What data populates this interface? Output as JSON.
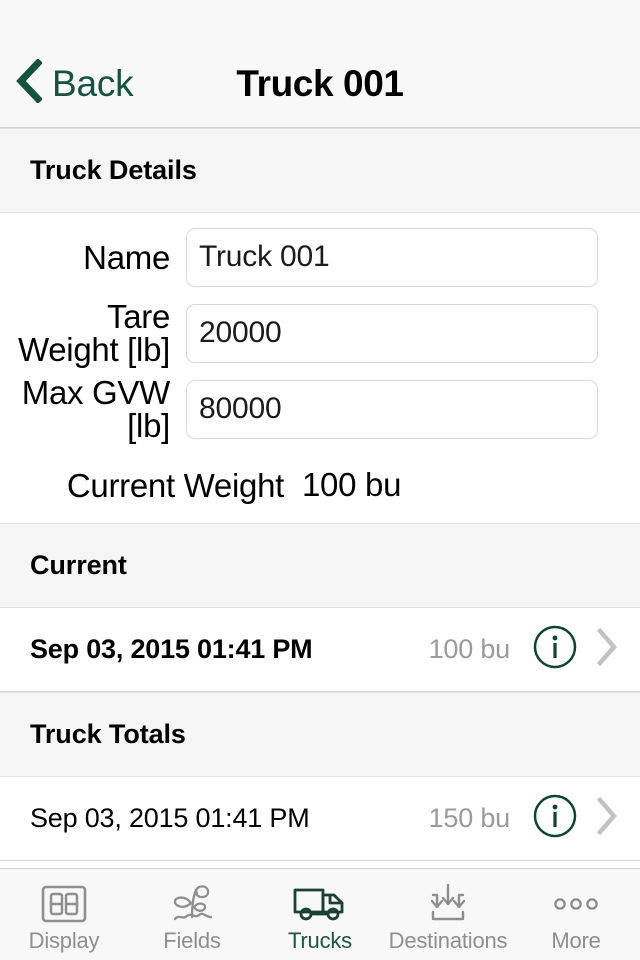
{
  "colors": {
    "accent_green": "#15523f",
    "tab_active_green": "#1e5440",
    "icon_gray": "#8e8e8e",
    "muted_text": "#9a9a9a",
    "section_band": "#f5f5f5",
    "navbar_bg": "#f8f8f8"
  },
  "navbar": {
    "back_label": "Back",
    "back_icon": "chevron-left-icon",
    "title": "Truck 001"
  },
  "sections": {
    "details": {
      "header": "Truck Details",
      "fields": [
        {
          "label": "Name",
          "value": "Truck 001",
          "type": "input",
          "name": "name-field"
        },
        {
          "label": "Tare Weight [lb]",
          "value": "20000",
          "type": "input",
          "name": "tare-weight-field"
        },
        {
          "label": "Max GVW [lb]",
          "value": "80000",
          "type": "input",
          "name": "max-gvw-field"
        },
        {
          "label": "Current Weight",
          "value": "100 bu",
          "type": "static",
          "name": "current-weight-value"
        }
      ]
    },
    "current": {
      "header": "Current",
      "rows": [
        {
          "date": "Sep 03, 2015 01:41 PM",
          "amount": "100 bu",
          "bold": true,
          "info_icon": "info-circle-icon",
          "disclosure_icon": "chevron-right-icon"
        }
      ]
    },
    "truck_totals": {
      "header": "Truck Totals",
      "rows": [
        {
          "date": "Sep 03, 2015 01:41 PM",
          "amount": "150 bu",
          "bold": false,
          "info_icon": "info-circle-icon",
          "disclosure_icon": "chevron-right-icon"
        }
      ]
    }
  },
  "tabbar": {
    "items": [
      {
        "label": "Display",
        "icon": "seven-segment-display-icon",
        "active": false
      },
      {
        "label": "Fields",
        "icon": "sprout-icon",
        "active": false
      },
      {
        "label": "Trucks",
        "icon": "truck-icon",
        "active": true
      },
      {
        "label": "Destinations",
        "icon": "arrows-into-bin-icon",
        "active": false
      },
      {
        "label": "More",
        "icon": "three-dots-icon",
        "active": false
      }
    ]
  }
}
